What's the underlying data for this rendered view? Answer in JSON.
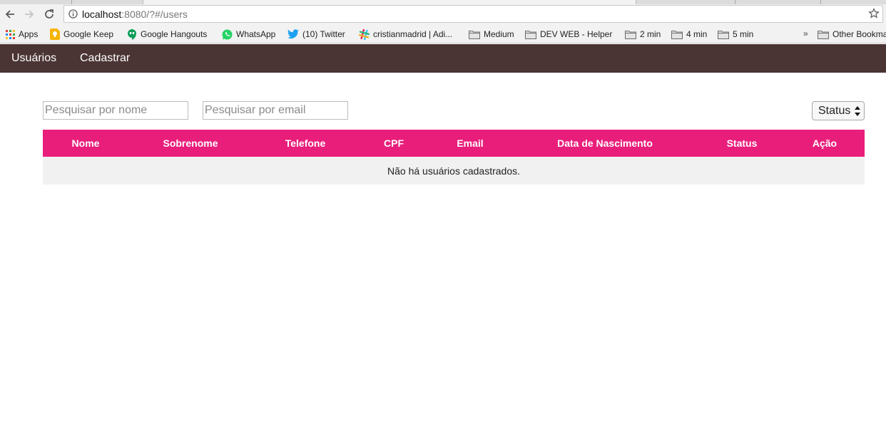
{
  "browser": {
    "url_host": "localhost",
    "url_path": ":8080/?#/users",
    "bookmarks": [
      {
        "label": "Apps",
        "icon": "apps-grid-icon"
      },
      {
        "label": "Google Keep",
        "icon": "google-keep-icon"
      },
      {
        "label": "Google Hangouts",
        "icon": "google-hangouts-icon"
      },
      {
        "label": "WhatsApp",
        "icon": "whatsapp-icon"
      },
      {
        "label": "(10) Twitter",
        "icon": "twitter-icon"
      },
      {
        "label": "cristianmadrid | Adi...",
        "icon": "slack-icon"
      },
      {
        "label": "Medium",
        "icon": "folder-icon"
      },
      {
        "label": "DEV WEB - Helper",
        "icon": "folder-icon"
      },
      {
        "label": "2 min",
        "icon": "folder-icon"
      },
      {
        "label": "4 min",
        "icon": "folder-icon"
      },
      {
        "label": "5 min",
        "icon": "folder-icon"
      },
      {
        "label": "Other Bookmarks",
        "icon": "folder-icon"
      }
    ],
    "overflow_label": "»"
  },
  "app": {
    "nav": {
      "users": "Usuários",
      "register": "Cadastrar"
    },
    "filters": {
      "name_placeholder": "Pesquisar por nome",
      "email_placeholder": "Pesquisar por email",
      "status_label": "Status"
    },
    "table": {
      "headers": [
        "Nome",
        "Sobrenome",
        "Telefone",
        "CPF",
        "Email",
        "Data de Nascimento",
        "Status",
        "Ação"
      ],
      "empty_message": "Não há usuários cadastrados."
    }
  },
  "colors": {
    "nav_bg": "#4b3434",
    "table_header_bg": "#e91e7b",
    "table_row_bg": "#f1f1f1"
  }
}
